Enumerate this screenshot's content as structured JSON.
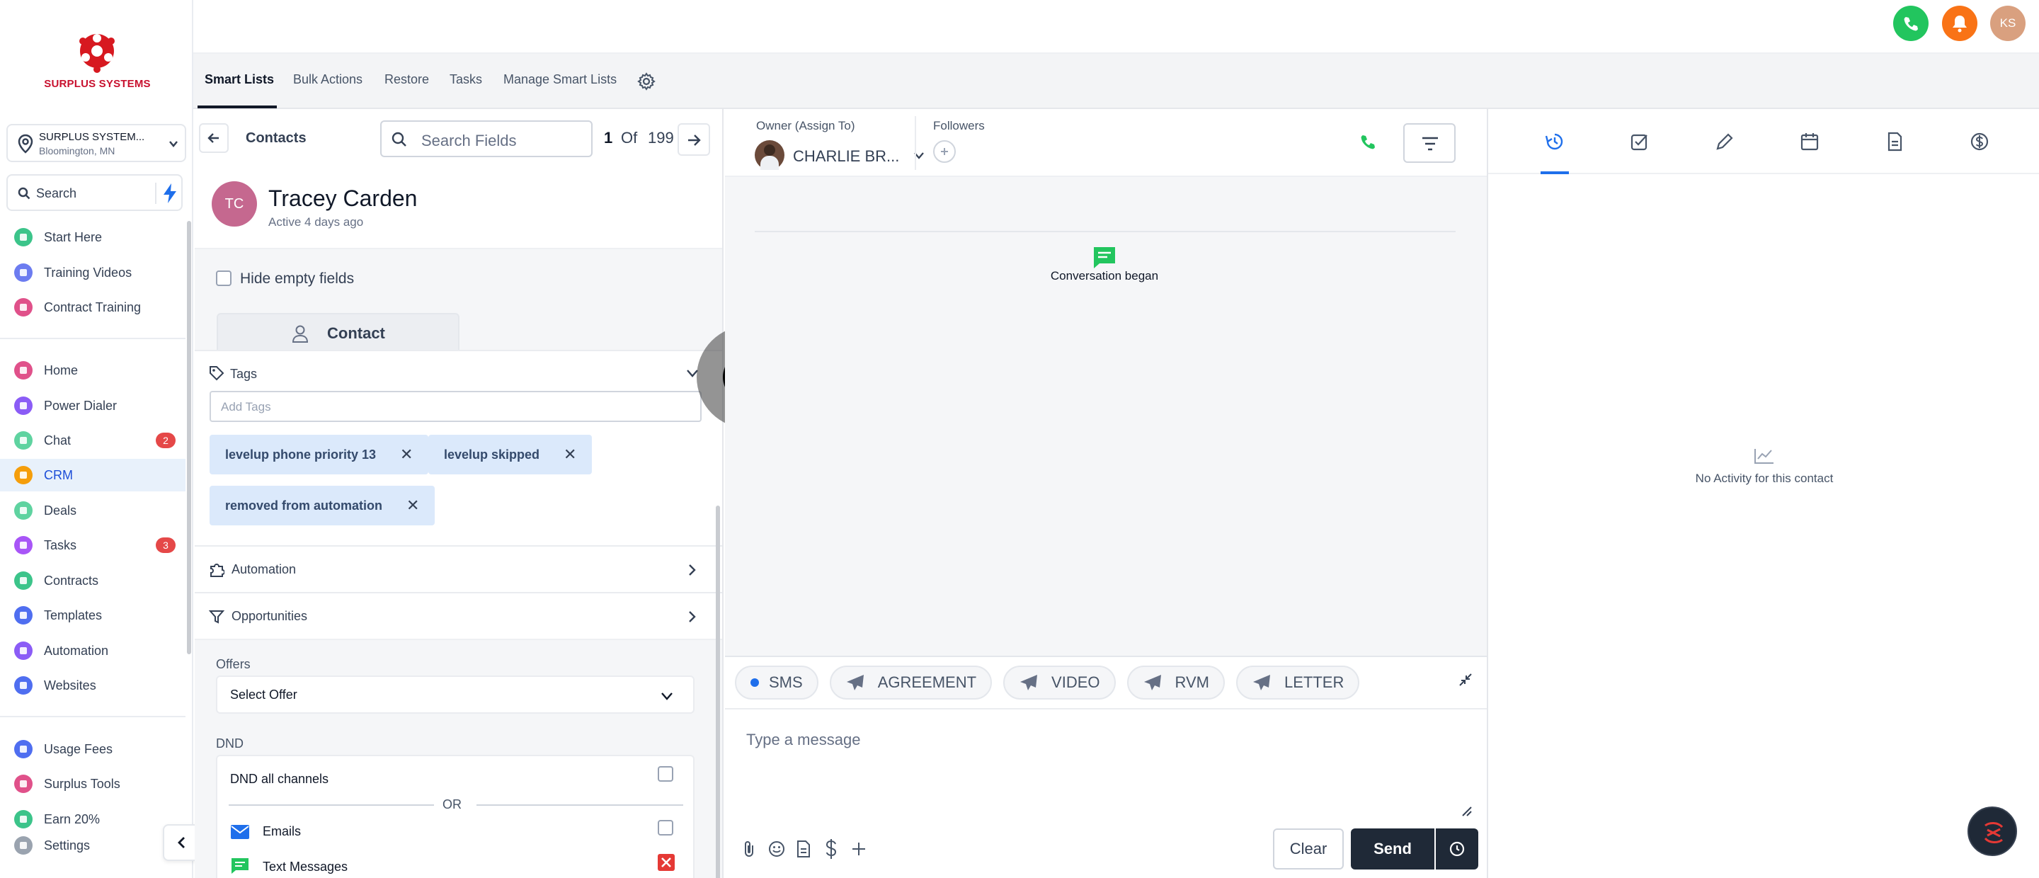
{
  "brand": {
    "name": "SURPLUS SYSTEMS"
  },
  "location": {
    "name": "SURPLUS SYSTEM...",
    "city": "Bloomington, MN"
  },
  "sidebar": {
    "search_placeholder": "Search",
    "groups": [
      {
        "items": [
          {
            "label": "Start Here",
            "color": "#3cc48a"
          },
          {
            "label": "Training Videos",
            "color": "#6c7cf0"
          },
          {
            "label": "Contract Training",
            "color": "#e0518a"
          }
        ]
      },
      {
        "items": [
          {
            "label": "Home",
            "color": "#e0518a"
          },
          {
            "label": "Power Dialer",
            "color": "#8b5cf6"
          },
          {
            "label": "Chat",
            "color": "#5fd3a0",
            "badge": "2"
          },
          {
            "label": "CRM",
            "color": "#f59e0b",
            "active": true
          },
          {
            "label": "Deals",
            "color": "#5fd3a0"
          },
          {
            "label": "Tasks",
            "color": "#a855f7",
            "badge": "3"
          },
          {
            "label": "Contracts",
            "color": "#3cc48a"
          },
          {
            "label": "Templates",
            "color": "#4f6ef0"
          },
          {
            "label": "Automation",
            "color": "#8b5cf6"
          },
          {
            "label": "Websites",
            "color": "#4f6ef0"
          }
        ]
      },
      {
        "items": [
          {
            "label": "Usage Fees",
            "color": "#4f6ef0"
          },
          {
            "label": "Surplus Tools",
            "color": "#e0518a"
          },
          {
            "label": "Earn 20%",
            "color": "#3cc48a"
          },
          {
            "label": "Settings",
            "color": "#9aa3af"
          }
        ]
      }
    ]
  },
  "topbar": {
    "avatar_initials": "KS"
  },
  "tabs": [
    "Smart Lists",
    "Bulk Actions",
    "Restore",
    "Tasks",
    "Manage Smart Lists"
  ],
  "contact_header": {
    "title": "Contacts",
    "search_placeholder": "Search Fields",
    "page_current": "1",
    "page_of": "Of",
    "page_total": "199"
  },
  "contact": {
    "initials": "TC",
    "name": "Tracey Carden",
    "status": "Active 4 days ago",
    "hide_empty_label": "Hide empty fields",
    "contact_tab": "Contact"
  },
  "tags": {
    "label": "Tags",
    "placeholder": "Add Tags",
    "items": [
      "levelup phone priority 13",
      "levelup skipped",
      "removed from automation"
    ]
  },
  "sections": {
    "automation": "Automation",
    "opportunities": "Opportunities"
  },
  "offers": {
    "label": "Offers",
    "value": "Select Offer"
  },
  "dnd": {
    "label": "DND",
    "all_channels": "DND all channels",
    "or": "OR",
    "emails": "Emails",
    "text_messages": "Text Messages"
  },
  "conversation": {
    "owner_label": "Owner (Assign To)",
    "owner_name": "CHARLIE BR...",
    "followers_label": "Followers",
    "event": "Conversation began",
    "channels": [
      "SMS",
      "AGREEMENT",
      "VIDEO",
      "RVM",
      "LETTER"
    ],
    "message_placeholder": "Type a message",
    "clear_label": "Clear",
    "send_label": "Send"
  },
  "activity": {
    "empty": "No Activity for this contact"
  },
  "colors": {
    "accent": "#1f6feb",
    "green": "#22c55e",
    "orange": "#f97316",
    "dark": "#1f2937"
  }
}
